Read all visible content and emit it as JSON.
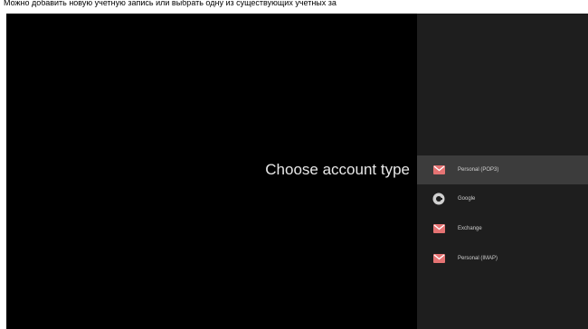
{
  "caption": {
    "text": "Можно добавить новую учетную запись или выбрать одну из существующих учетных за"
  },
  "screen": {
    "title": "Choose account type"
  },
  "account_types": [
    {
      "label": "Personal (POP3)",
      "icon": "mail-icon",
      "selected": true
    },
    {
      "label": "Google",
      "icon": "google-icon",
      "selected": false
    },
    {
      "label": "Exchange",
      "icon": "mail-icon",
      "selected": false
    },
    {
      "label": "Personal (IMAP)",
      "icon": "mail-icon",
      "selected": false
    }
  ],
  "colors": {
    "background": "#000000",
    "panel": "#1e1e1e",
    "selected_row": "#3c3c3c",
    "mail_icon": "#e57373",
    "google_icon": "#d0d0d0"
  }
}
